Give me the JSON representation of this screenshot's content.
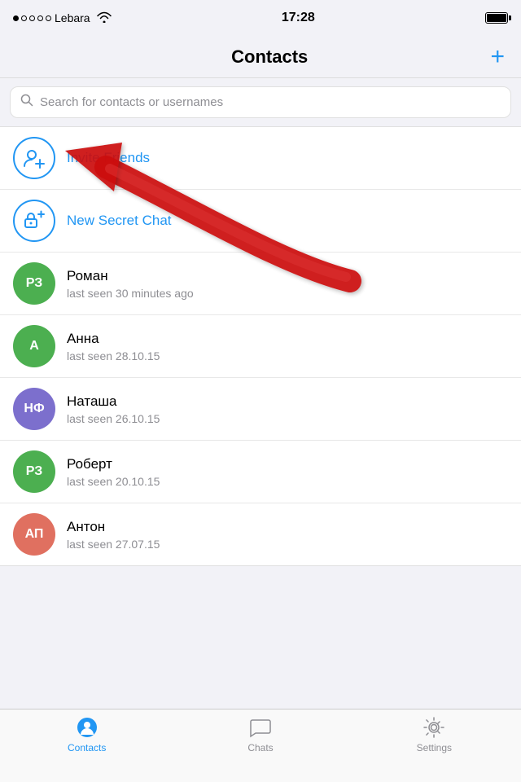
{
  "statusBar": {
    "carrier": "Lebara",
    "time": "17:28"
  },
  "navBar": {
    "title": "Contacts",
    "addButton": "+"
  },
  "search": {
    "placeholder": "Search for contacts or usernames"
  },
  "specialItems": [
    {
      "id": "invite-friends",
      "label": "Invite Friends",
      "iconType": "invite"
    },
    {
      "id": "new-secret-chat",
      "label": "New Secret Chat",
      "iconType": "secret"
    }
  ],
  "contacts": [
    {
      "id": "roman",
      "initials": "РЗ",
      "name": "Роман",
      "status": "last seen 30 minutes ago",
      "avatarColor": "green"
    },
    {
      "id": "anna",
      "initials": "А",
      "name": "Анна",
      "status": "last seen 28.10.15",
      "avatarColor": "green"
    },
    {
      "id": "natasha",
      "initials": "НФ",
      "name": "Наташа",
      "status": "last seen 26.10.15",
      "avatarColor": "purple"
    },
    {
      "id": "robert",
      "initials": "РЗ",
      "name": "Роберт",
      "status": "last seen 20.10.15",
      "avatarColor": "green"
    },
    {
      "id": "anton",
      "initials": "АП",
      "name": "Антон",
      "status": "last seen 27.07.15",
      "avatarColor": "salmon"
    }
  ],
  "tabBar": {
    "tabs": [
      {
        "id": "contacts",
        "label": "Contacts",
        "active": true
      },
      {
        "id": "chats",
        "label": "Chats",
        "active": false
      },
      {
        "id": "settings",
        "label": "Settings",
        "active": false
      }
    ]
  }
}
